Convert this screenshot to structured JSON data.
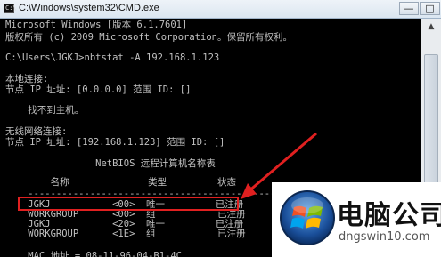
{
  "window": {
    "title": "C:\\Windows\\system32\\CMD.exe",
    "minimize_glyph": "—",
    "maximize_glyph": "□"
  },
  "console": {
    "lines": [
      "Microsoft Windows [版本 6.1.7601]",
      "版权所有 (c) 2009 Microsoft Corporation。保留所有权利。",
      "",
      "C:\\Users\\JGKJ>nbtstat -A 192.168.1.123",
      "",
      "本地连接:",
      "节点 IP 址址: [0.0.0.0] 范围 ID: []",
      "",
      "    找不到主机。",
      "",
      "无线网络连接:",
      "节点 IP 址址: [192.168.1.123] 范围 ID: []",
      "",
      "                NetBIOS 远程计算机名称表",
      "",
      "        名称              类型         状态",
      "    ---------------------------------------------",
      "    JGKJ           <00>  唯一         已注册",
      "    WORKGROUP      <00>  组           已注册",
      "    JGKJ           <20>  唯一         已注册",
      "    WORKGROUP      <1E>  组           已注册",
      "",
      "    MAC 地址 = 08-11-96-04-B1-4C"
    ]
  },
  "scrollbar": {
    "up_arrow": "▲",
    "down_arrow": "▼"
  },
  "watermark": {
    "brand": "电脑公司",
    "url": "dngswin10.com"
  },
  "annotation_color": "#e02020"
}
